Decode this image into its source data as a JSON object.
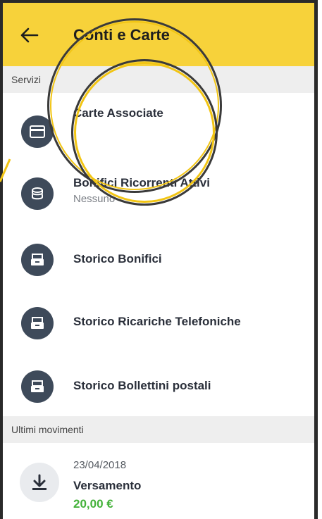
{
  "header": {
    "title": "Conti e Carte",
    "back_icon": "arrow-left-icon"
  },
  "services": {
    "section_label": "Servizi",
    "items": [
      {
        "label": "Carte Associate",
        "sub": "",
        "icon": "card-icon"
      },
      {
        "label": "Bonifici Ricorrenti Attivi",
        "sub": "Nessuno",
        "icon": "coins-icon"
      },
      {
        "label": "Storico Bonifici",
        "sub": "",
        "icon": "archive-icon"
      },
      {
        "label": "Storico Ricariche Telefoniche",
        "sub": "",
        "icon": "archive-icon"
      },
      {
        "label": "Storico Bollettini postali",
        "sub": "",
        "icon": "archive-icon"
      }
    ]
  },
  "movements": {
    "section_label": "Ultimi movimenti",
    "items": [
      {
        "date": "23/04/2018",
        "title": "Versamento",
        "amount": "20,00 €",
        "icon": "download-icon"
      }
    ]
  },
  "colors": {
    "accent_yellow": "#f7d23a",
    "icon_dark": "#3e4a5a",
    "amount_green": "#44b23a",
    "section_bg": "#eeeeee"
  }
}
